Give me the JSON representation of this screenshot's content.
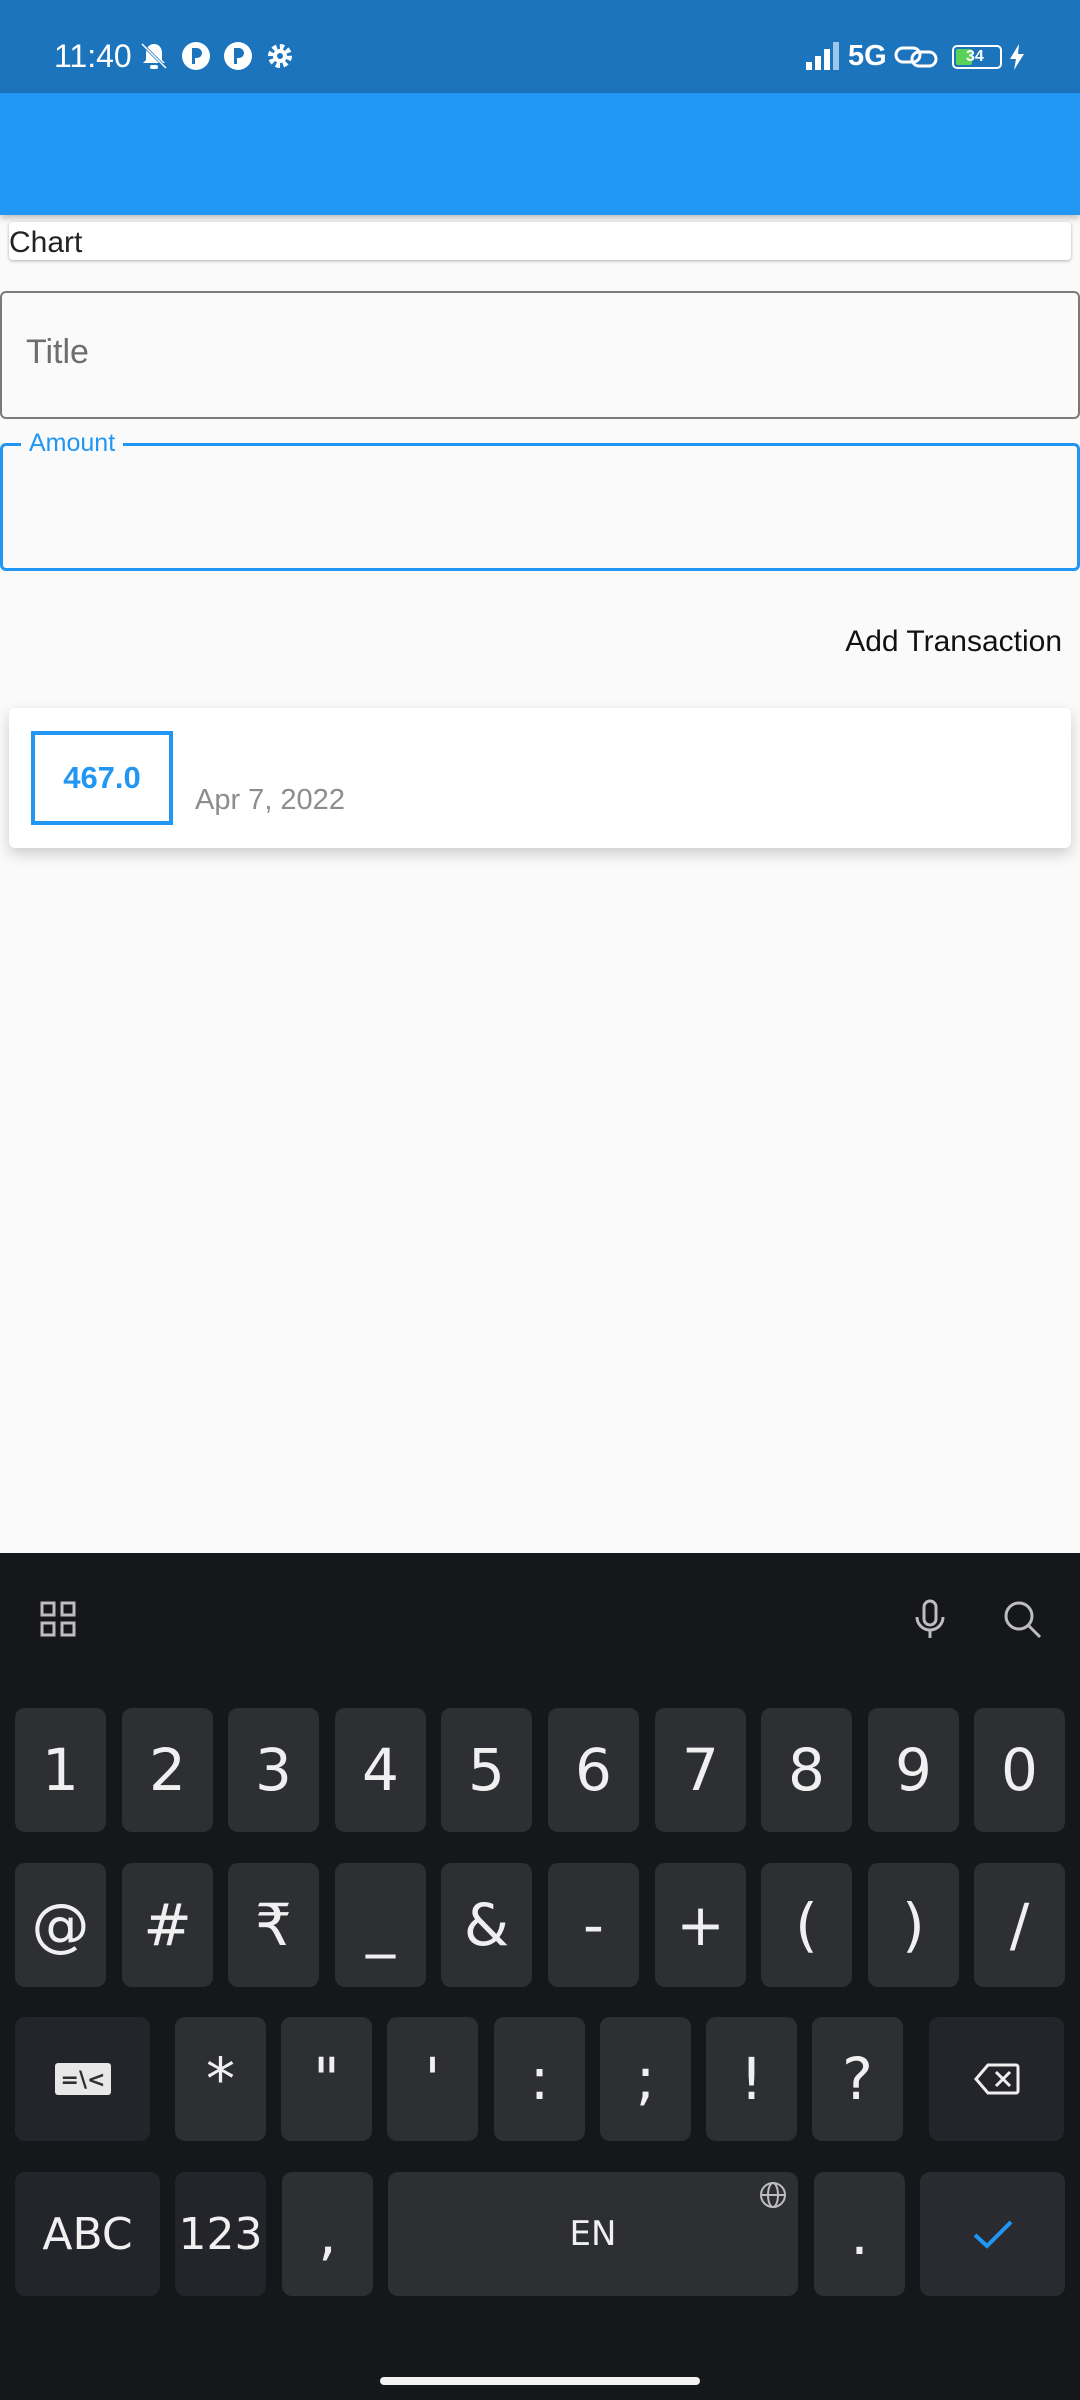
{
  "status_bar": {
    "time": "11:40",
    "network": "5G",
    "battery": "34"
  },
  "chart": {
    "label": "Chart"
  },
  "form": {
    "title_placeholder": "Title",
    "amount_label": "Amount",
    "add_button": "Add Transaction"
  },
  "transactions": [
    {
      "amount": "467.0",
      "date": "Apr 7, 2022"
    }
  ],
  "keyboard": {
    "row1": [
      "1",
      "2",
      "3",
      "4",
      "5",
      "6",
      "7",
      "8",
      "9",
      "0"
    ],
    "row2": [
      "@",
      "#",
      "₹",
      "_",
      "&",
      "-",
      "+",
      "(",
      ")",
      "/"
    ],
    "row3": [
      "*",
      "\"",
      "'",
      ":",
      ";",
      "!",
      "?"
    ],
    "abc": "ABC",
    "num": "123",
    "comma": ",",
    "space": "EN",
    "period": "."
  },
  "colors": {
    "app_bar": "#2196f3",
    "status_bar": "#1c74bd",
    "accent": "#2196f3"
  }
}
